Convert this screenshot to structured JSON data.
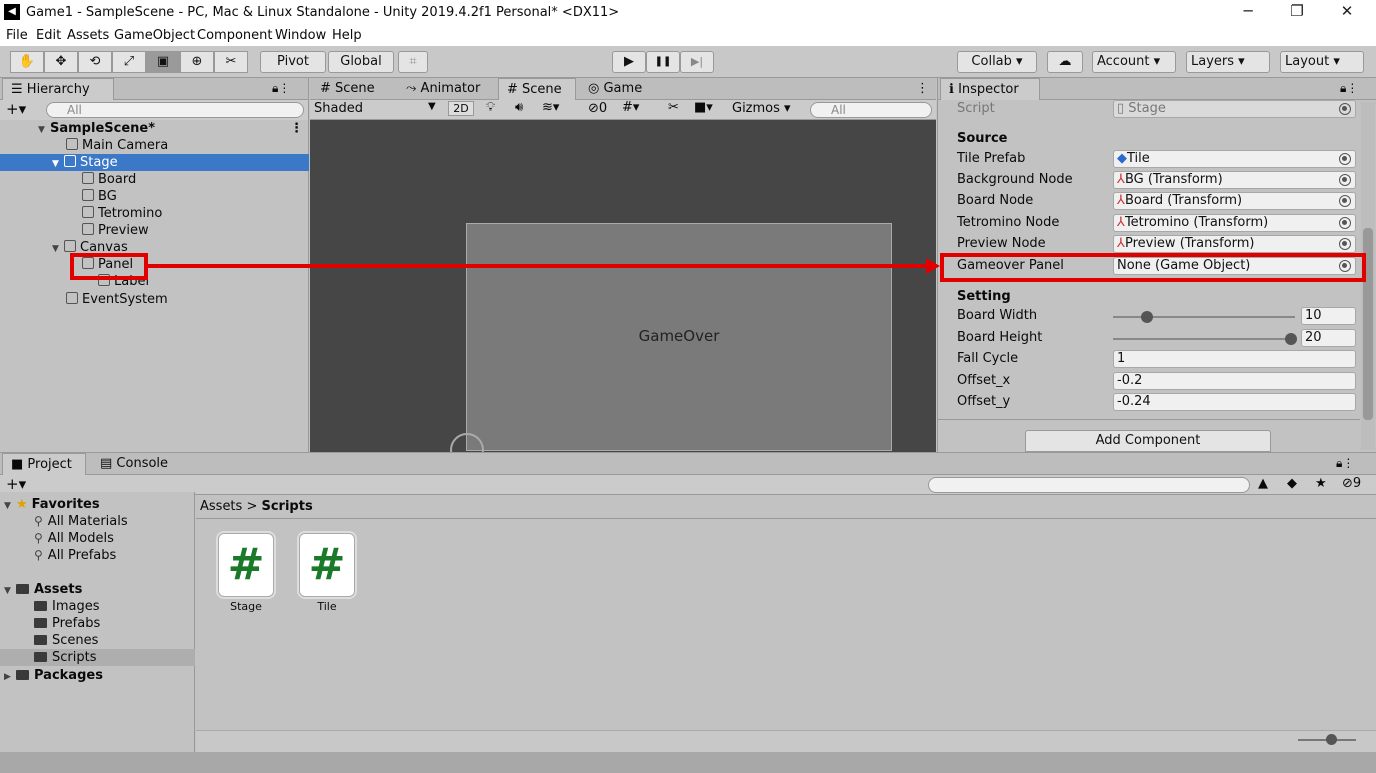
{
  "window": {
    "title": "Game1 - SampleScene - PC, Mac & Linux Standalone - Unity 2019.4.2f1 Personal* <DX11>",
    "app_icon": "unity-icon",
    "minimize": "─",
    "restore": "❐",
    "close": "✕"
  },
  "menu": [
    "File",
    "Edit",
    "Assets",
    "GameObject",
    "Component",
    "Window",
    "Help"
  ],
  "toolbar": {
    "tools": [
      "✋",
      "✥",
      "⟲",
      "⤢",
      "▣",
      "⊕",
      "✂"
    ],
    "pivot": "Pivot",
    "global": "Global",
    "grid_icon": "⌗",
    "play": "▶",
    "pause": "❚❚",
    "step": "▶|",
    "collab": "Collab",
    "cloud_icon": "☁",
    "account": "Account",
    "layers": "Layers",
    "layout": "Layout"
  },
  "hierarchy": {
    "tab": "Hierarchy",
    "search_placeholder": "All",
    "scene": "SampleScene*",
    "items": [
      "Main Camera",
      "Stage",
      "Board",
      "BG",
      "Tetromino",
      "Preview",
      "Canvas",
      "Panel",
      "Label",
      "EventSystem"
    ]
  },
  "scene_view": {
    "tabs": [
      "Scene",
      "Animator",
      "Scene",
      "Game"
    ],
    "shading": "Shaded",
    "mode_2d": "2D",
    "fx_count": "0",
    "gizmos": "Gizmos",
    "search_placeholder": "All",
    "panel_text": "GameOver"
  },
  "inspector": {
    "tab": "Inspector",
    "script_label": "Script",
    "script_value": "Stage",
    "source_header": "Source",
    "fields": [
      {
        "label": "Tile Prefab",
        "value": "Tile"
      },
      {
        "label": "Background Node",
        "value": "BG (Transform)"
      },
      {
        "label": "Board Node",
        "value": "Board (Transform)"
      },
      {
        "label": "Tetromino Node",
        "value": "Tetromino (Transform)"
      },
      {
        "label": "Preview Node",
        "value": "Preview (Transform)"
      },
      {
        "label": "Gameover Panel",
        "value": "None (Game Object)"
      }
    ],
    "setting_header": "Setting",
    "board_width_label": "Board Width",
    "board_width": "10",
    "board_height_label": "Board Height",
    "board_height": "20",
    "fall_cycle_label": "Fall Cycle",
    "fall_cycle": "1",
    "offset_x_label": "Offset_x",
    "offset_x": "-0.2",
    "offset_y_label": "Offset_y",
    "offset_y": "-0.24",
    "add_component": "Add Component"
  },
  "project": {
    "tabs": [
      "Project",
      "Console"
    ],
    "hidden_count": "9",
    "favorites": "Favorites",
    "fav_items": [
      "All Materials",
      "All Models",
      "All Prefabs"
    ],
    "assets": "Assets",
    "asset_folders": [
      "Images",
      "Prefabs",
      "Scenes",
      "Scripts"
    ],
    "packages": "Packages",
    "breadcrumb_root": "Assets",
    "breadcrumb_current": "Scripts",
    "files": [
      "Stage",
      "Tile"
    ]
  },
  "annotation_color": "#e00000"
}
